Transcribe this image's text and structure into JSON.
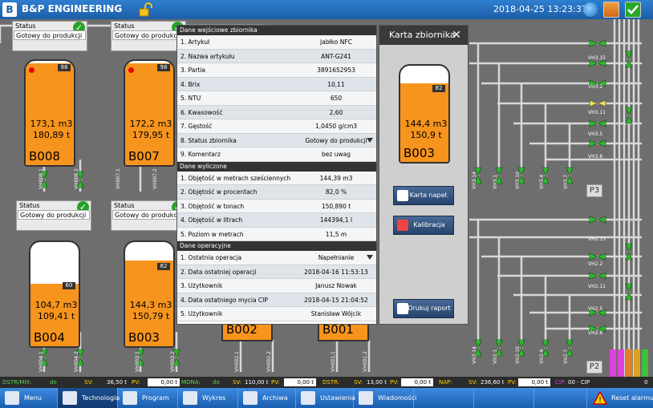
{
  "header": {
    "logo_text": "B",
    "title": "B&P ENGINEERING",
    "datetime": "2018-04-25 13:23:37"
  },
  "status_cards": [
    {
      "label": "Status",
      "value": "Gotowy do produkcji"
    },
    {
      "label": "Status",
      "value": "Gotowy do produkcji"
    },
    {
      "label": "Status",
      "value": "Gotowy do produkcji"
    },
    {
      "label": "Status",
      "value": "Gotowy do produkcji"
    }
  ],
  "tanks": [
    {
      "name": "B008",
      "volume": "173,1 m3",
      "mass": "180,89 t",
      "percent": "98",
      "fill": 0.98
    },
    {
      "name": "B007",
      "volume": "172,2 m3",
      "mass": "179,95 t",
      "percent": "98",
      "fill": 0.98
    },
    {
      "name": "B004",
      "volume": "104,7 m3",
      "mass": "109,41 t",
      "percent": "60",
      "fill": 0.6
    },
    {
      "name": "B003",
      "volume": "144,3 m3",
      "mass": "150,79 t",
      "percent": "82",
      "fill": 0.82
    },
    {
      "name": "B002"
    },
    {
      "name": "B001"
    }
  ],
  "valve_labels": {
    "left_top": [
      "VH008.1",
      "VH008.2",
      "VH007.1",
      "VH007.2"
    ],
    "left_bottom": [
      "VH004.1",
      "VH004.2",
      "VH003.1",
      "VH003.2",
      "VH002.1",
      "VH002.2",
      "VH001.1",
      "VH001.2"
    ],
    "right_top": [
      "VH3.14",
      "VH3.1",
      "VH3.10",
      "VH3.4",
      "VH3.7"
    ],
    "right_bottom": [
      "VH2.14",
      "VH2.1",
      "VH2.10",
      "VH2.4",
      "VH2.7"
    ],
    "manifold_p3": [
      "VH3.15",
      "VH3.2",
      "VH3.11",
      "VH3.5",
      "VH3.8"
    ],
    "manifold_p2": [
      "VH2.15",
      "VH2.2",
      "VH2.11",
      "VH2.5",
      "VH2.8"
    ]
  },
  "panels": {
    "p3": "P3",
    "p2": "P2"
  },
  "data_panel": {
    "section1_title": "Dane wejściowe zbiornika",
    "section1_rows": [
      {
        "label": "1. Artykuł",
        "value": "Jabłko NFC"
      },
      {
        "label": "2. Nazwa artykułu",
        "value": "ANT-G241"
      },
      {
        "label": "3. Partia",
        "value": "3891652953"
      },
      {
        "label": "4. Brix",
        "value": "10,11"
      },
      {
        "label": "5. NTU",
        "value": "650"
      },
      {
        "label": "6. Kwasowość",
        "value": "2,60"
      },
      {
        "label": "7. Gęstość",
        "value": "1,0450 g/cm3"
      },
      {
        "label": "8. Status zbiornika",
        "value": "Gotowy do produkcji"
      },
      {
        "label": "9. Komentarz",
        "value": "bez uwag"
      }
    ],
    "section2_title": "Dane wyliczone",
    "section2_rows": [
      {
        "label": "1. Objętość w metrach sześciennych",
        "value": "144,39 m3"
      },
      {
        "label": "2. Objętość w procentach",
        "value": "82,0 %"
      },
      {
        "label": "3. Objętość w tonach",
        "value": "150,890 t"
      },
      {
        "label": "4. Objętość w litrach",
        "value": "144394,1 l"
      },
      {
        "label": "5. Poziom w metrach",
        "value": "11,5 m"
      }
    ],
    "section3_title": "Dane operacyjne",
    "section3_rows": [
      {
        "label": "1. Ostatnia operacja",
        "value": "Napełnianie"
      },
      {
        "label": "2. Data ostatniej operacji",
        "value": "2018-04-16 11:53:13"
      },
      {
        "label": "3. Użytkownik",
        "value": "Janusz Nowak"
      },
      {
        "label": "4. Data ostatniego mycia CIP",
        "value": "2018-04-15 21:04:52"
      },
      {
        "label": "5. Użytkownik",
        "value": "Stanisław Wójcik"
      }
    ]
  },
  "card_panel": {
    "title": "Karta zbiornika",
    "tank": {
      "name": "B003",
      "volume": "144,4 m3",
      "mass": "150,9 t",
      "percent": "82",
      "fill": 0.82
    },
    "btn_fill_card": "Karta napeł.",
    "btn_calibration": "Kalibracja",
    "btn_print": "Drukuj raport"
  },
  "statusbar": {
    "dstr_mix_label": "DSTR/MIX:",
    "dstr_mix_state": "do",
    "sv1_label": "SV:",
    "sv1": "36,50 t",
    "pv1_label": "PV:",
    "pv1": "0,00 t",
    "mona_label": "MONA:",
    "mona_state": "do",
    "sv2_label": "SV:",
    "sv2": "110,00 t",
    "pv2_label": "PV:",
    "pv2": "0,00 t",
    "dstr_label": "DSTR:",
    "sv3_label": "SV:",
    "sv3": "13,00 t",
    "pv3_label": "PV:",
    "pv3": "0,00 t",
    "nap_label": "NAP:",
    "sv4_label": "SV:",
    "sv4": "236,60 t",
    "pv4_label": "PV:",
    "pv4": "0,00 t",
    "cip_label": "CIP:",
    "cip_value": "00 - CIP",
    "end_value": "0"
  },
  "nav": {
    "menu": "Menu",
    "technologia": "Technologia",
    "program": "Program",
    "wykres": "Wykres",
    "archiwa": "Archiwa",
    "ustawienia": "Ustawienia",
    "wiadomosci": "Wiadomości",
    "reset": "Reset alarmu"
  },
  "colors": {
    "product": "#f7941d",
    "header_blue": "#1c5ea8",
    "valve_green": "#2fb82f",
    "ok_green": "#27a02a"
  }
}
